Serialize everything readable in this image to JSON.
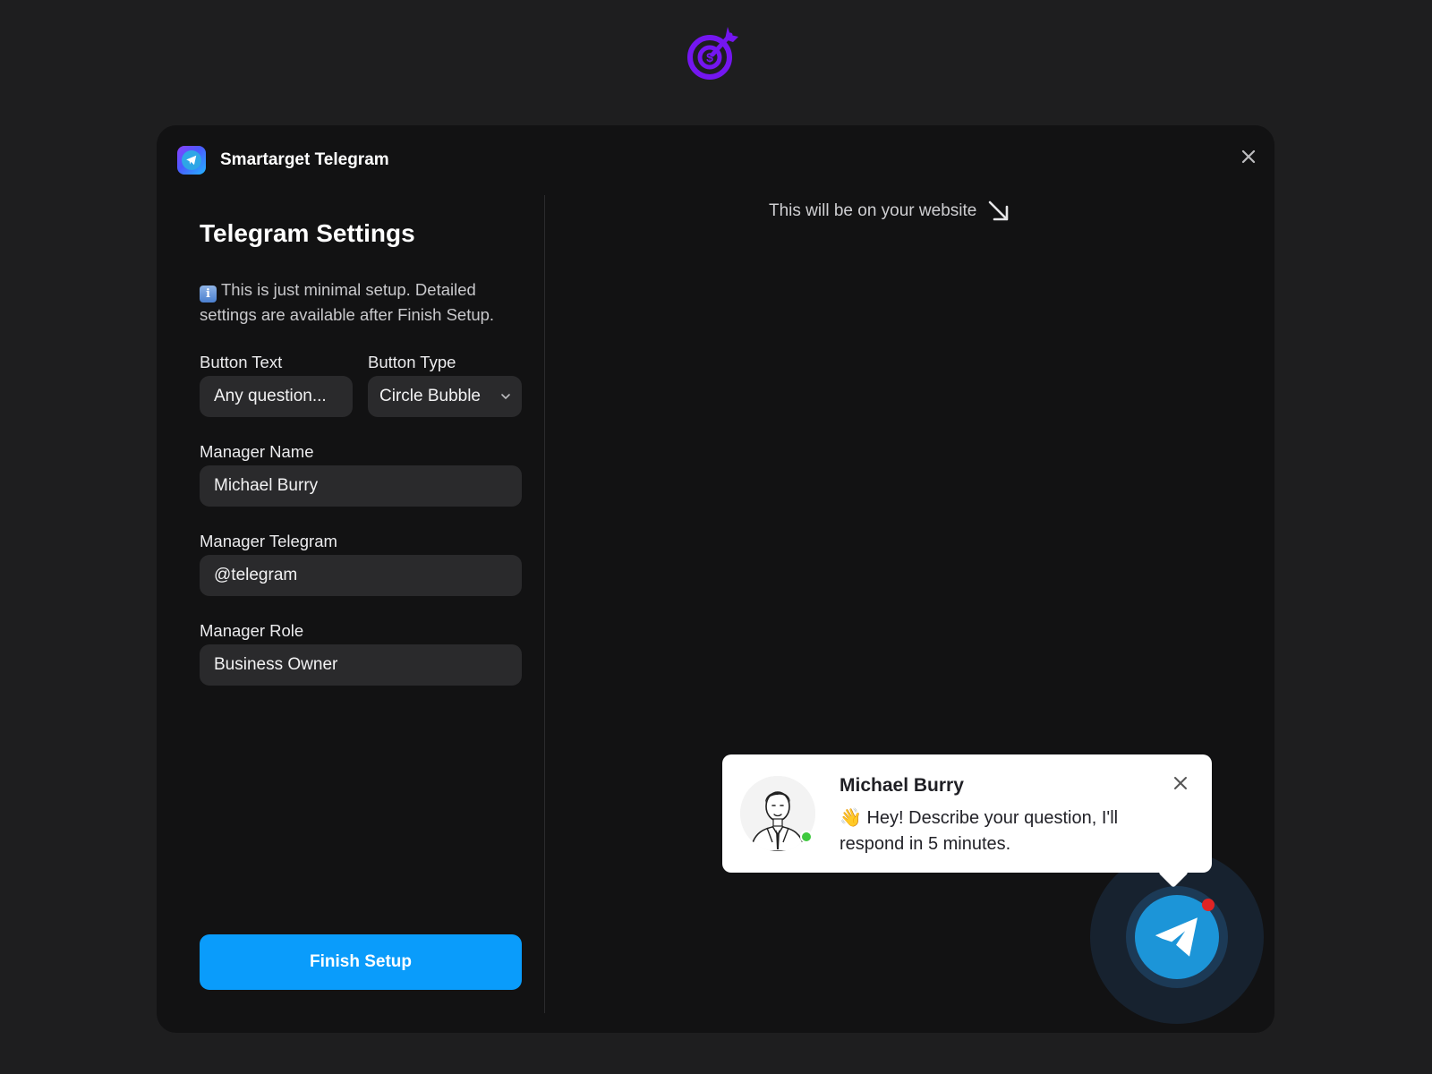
{
  "app": {
    "title": "Smartarget Telegram"
  },
  "settings": {
    "heading": "Telegram Settings",
    "info": "This is just minimal setup. Detailed settings are available after Finish Setup.",
    "button_text": {
      "label": "Button Text",
      "value": "Any question..."
    },
    "button_type": {
      "label": "Button Type",
      "value": "Circle Bubble"
    },
    "manager_name": {
      "label": "Manager Name",
      "value": "Michael Burry"
    },
    "manager_telegram": {
      "label": "Manager Telegram",
      "value": "@telegram"
    },
    "manager_role": {
      "label": "Manager Role",
      "value": "Business Owner"
    },
    "finish_label": "Finish Setup"
  },
  "preview": {
    "hint": "This will be on your website",
    "popup": {
      "name": "Michael Burry",
      "emoji": "👋",
      "message": "Hey! Describe your question, I'll respond in 5 minutes."
    }
  },
  "colors": {
    "accent": "#0a9cfb",
    "logo": "#7416f0",
    "telegram_blue": "#1c95d8",
    "online": "#3ec93e",
    "badge": "#e02424"
  },
  "icons": {
    "brand": "target-dollar-icon",
    "app": "telegram-plane-icon",
    "close": "close-icon",
    "info": "info-icon",
    "dropdown": "chevron-down-icon",
    "hint_arrow": "arrow-down-right-icon",
    "bubble": "telegram-plane-icon"
  }
}
